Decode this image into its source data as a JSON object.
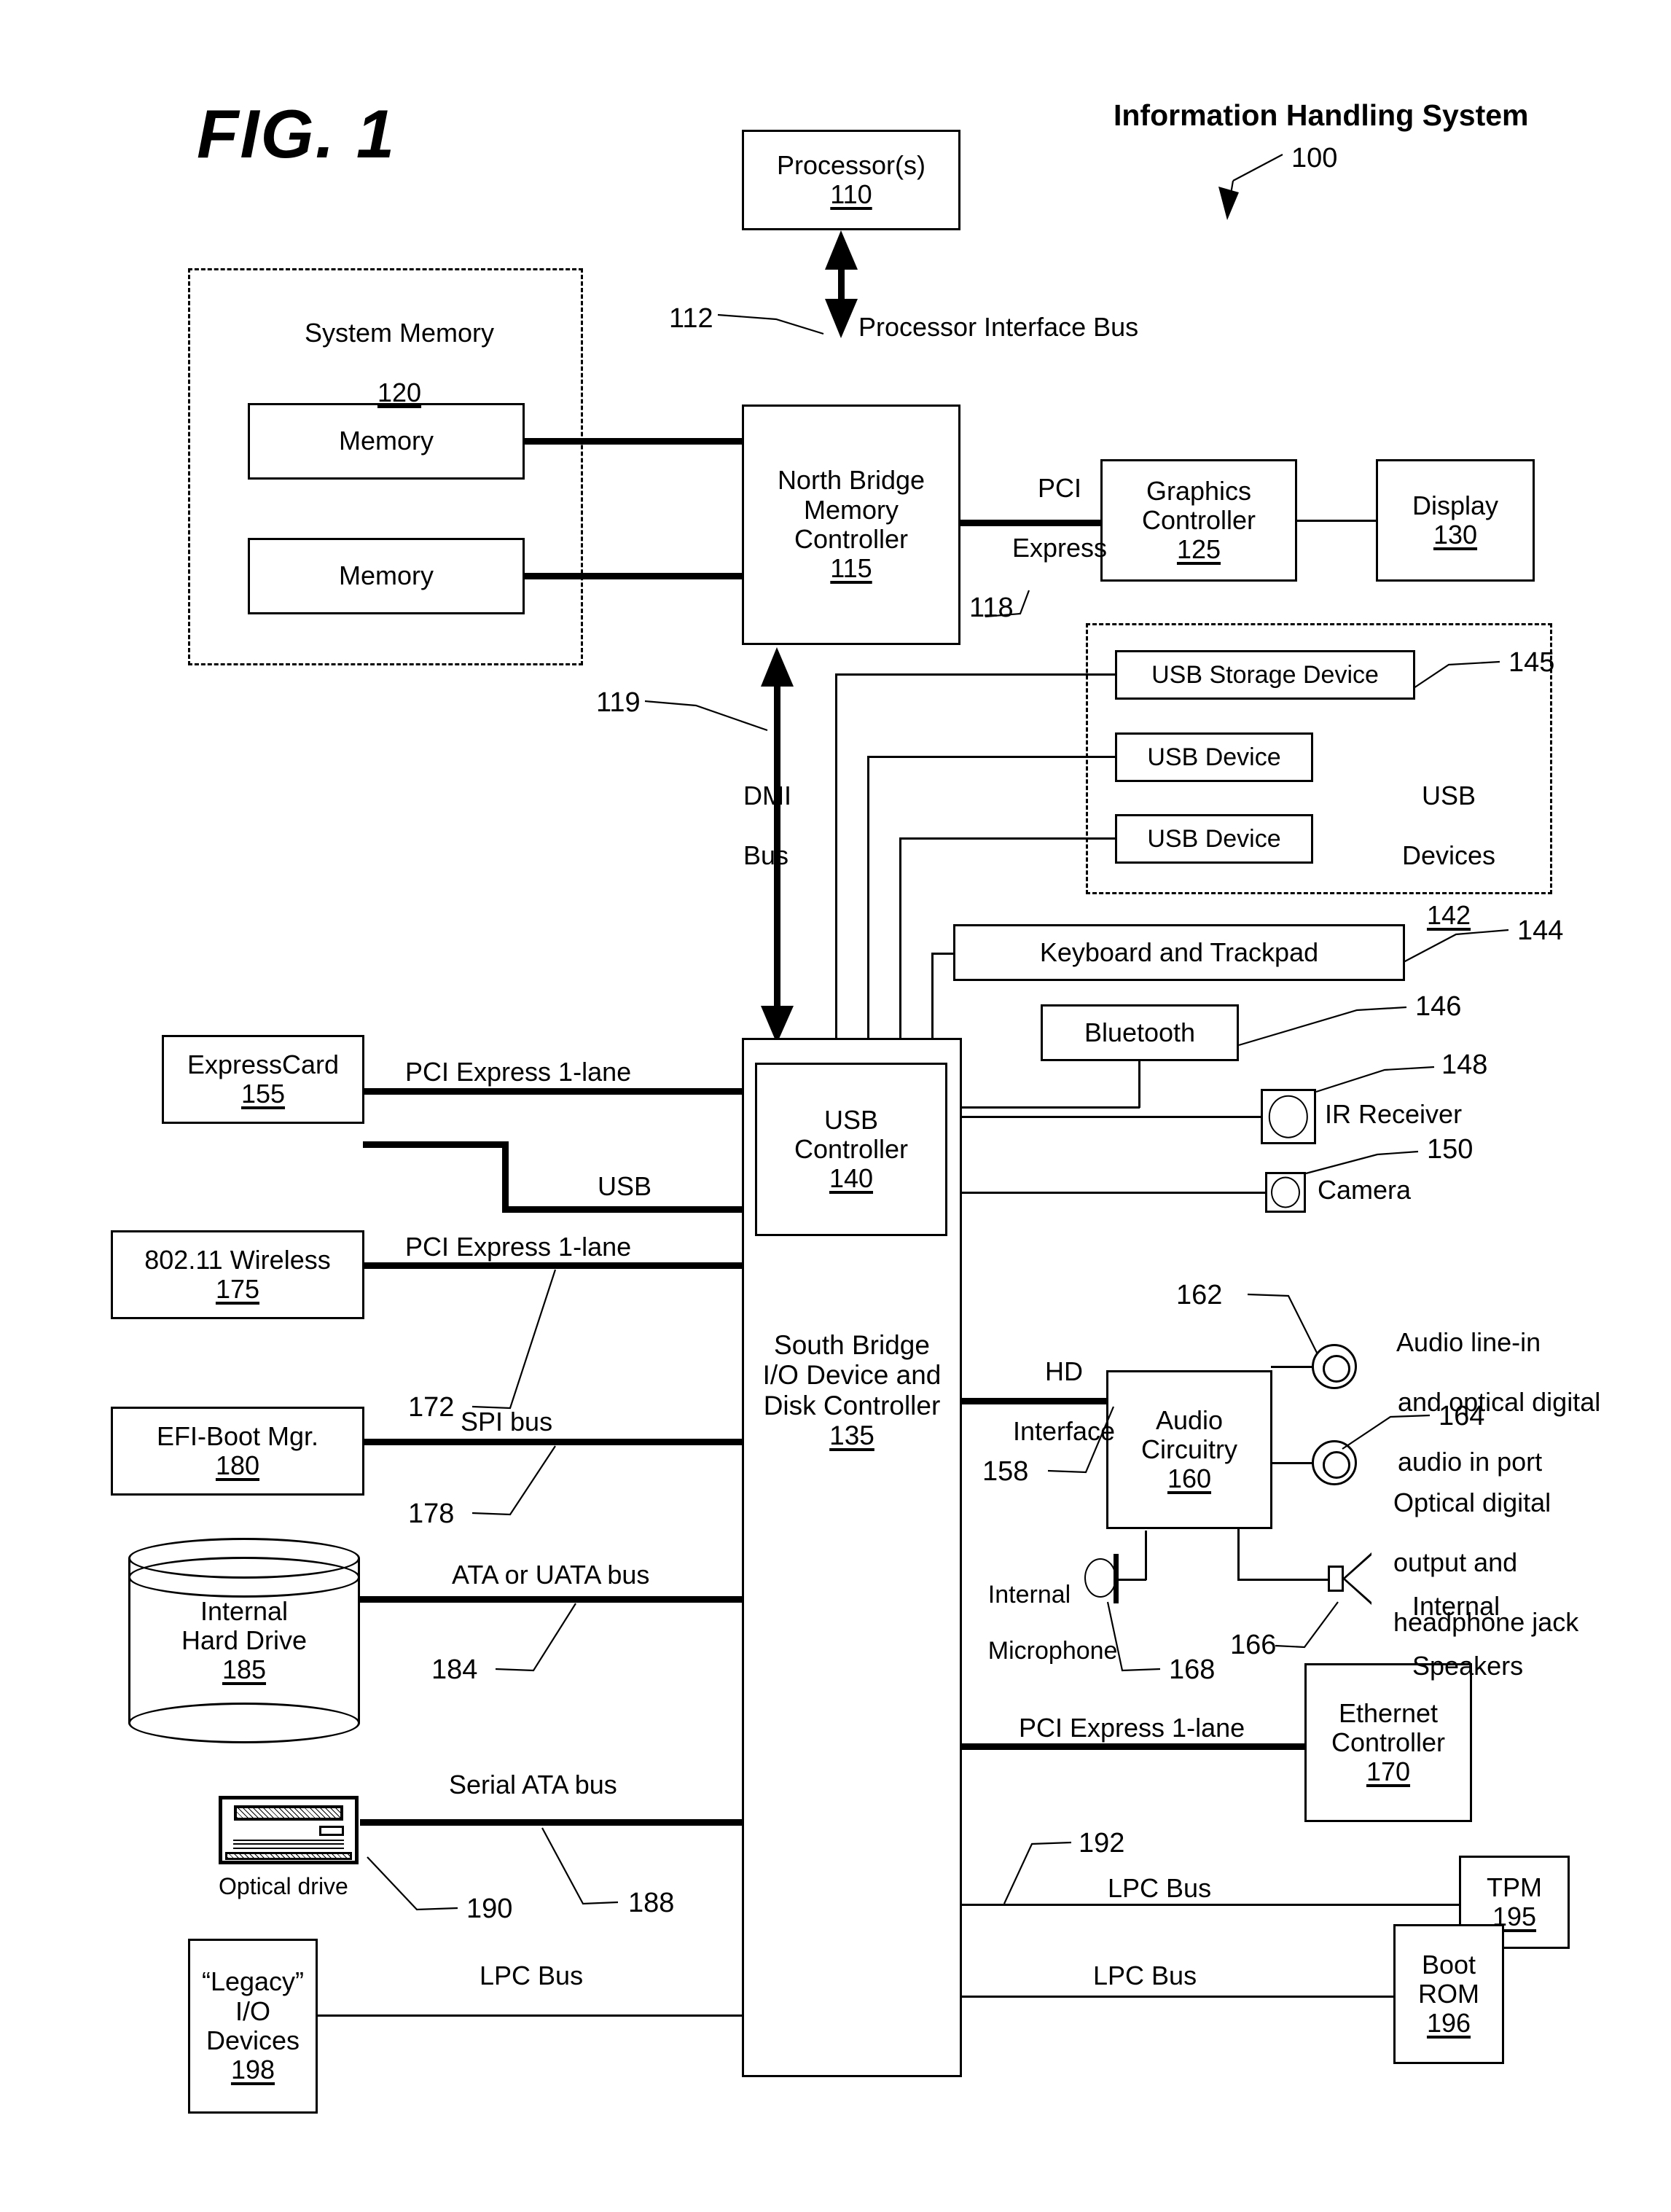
{
  "figure": {
    "fig_label": "FIG. 1",
    "system_title": "Information Handling System",
    "system_ref": "100"
  },
  "blocks": {
    "processor": {
      "title": "Processor(s)",
      "ref": "110"
    },
    "north_bridge": {
      "line1": "North Bridge",
      "line2": "Memory",
      "line3": "Controller",
      "ref": "115"
    },
    "system_memory": {
      "title": "System Memory",
      "ref": "120"
    },
    "memory_1": {
      "title": "Memory"
    },
    "memory_2": {
      "title": "Memory"
    },
    "graphics_controller": {
      "line1": "Graphics",
      "line2": "Controller",
      "ref": "125"
    },
    "display": {
      "title": "Display",
      "ref": "130"
    },
    "usb_storage_device": {
      "title": "USB Storage Device",
      "ref": "145"
    },
    "usb_device_1": {
      "title": "USB Device"
    },
    "usb_device_2": {
      "title": "USB Device"
    },
    "usb_devices_group": {
      "line1": "USB",
      "line2": "Devices",
      "ref": "142"
    },
    "keyboard_trackpad": {
      "title": "Keyboard and Trackpad",
      "ref": "144"
    },
    "bluetooth": {
      "title": "Bluetooth",
      "ref": "146"
    },
    "ir_receiver": {
      "title": "IR Receiver",
      "ref": "148"
    },
    "camera": {
      "title": "Camera",
      "ref": "150"
    },
    "usb_controller": {
      "line1": "USB",
      "line2": "Controller",
      "ref": "140"
    },
    "south_bridge": {
      "line1": "South Bridge",
      "line2": "I/O Device and",
      "line3": "Disk Controller",
      "ref": "135"
    },
    "expresscard": {
      "title": "ExpressCard",
      "ref": "155"
    },
    "wireless": {
      "title": "802.11 Wireless",
      "ref": "175"
    },
    "efi_boot_mgr": {
      "title": "EFI-Boot Mgr.",
      "ref": "180"
    },
    "internal_hard_drive": {
      "line1": "Internal",
      "line2": "Hard Drive",
      "ref": "185"
    },
    "optical_drive": {
      "title": "Optical drive",
      "ref": "190"
    },
    "legacy_io_devices": {
      "line1": "“Legacy”",
      "line2": "I/O",
      "line3": "Devices",
      "ref": "198"
    },
    "audio_circuitry": {
      "line1": "Audio",
      "line2": "Circuitry",
      "ref": "160"
    },
    "audio_line_in": {
      "line1": "Audio line-in",
      "line2": "and optical digital",
      "line3": "audio in port",
      "ref": "162"
    },
    "optical_out": {
      "line1": "Optical digital",
      "line2": "output and",
      "line3": "headphone jack",
      "ref": "164"
    },
    "internal_microphone": {
      "line1": "Internal",
      "line2": "Microphone",
      "ref": "168"
    },
    "internal_speakers": {
      "line1": "Internal",
      "line2": "Speakers",
      "ref": "166"
    },
    "ethernet_controller": {
      "line1": "Ethernet",
      "line2": "Controller",
      "ref": "170"
    },
    "tpm": {
      "title": "TPM",
      "ref": "195"
    },
    "boot_rom": {
      "line1": "Boot",
      "line2": "ROM",
      "ref": "196"
    }
  },
  "buses": {
    "processor_interface_bus": {
      "label": "Processor Interface Bus",
      "ref": "112"
    },
    "pci_express_gfx": {
      "line1": "PCI",
      "line2": "Express",
      "ref": "118"
    },
    "dmi_bus": {
      "line1": "DMI",
      "line2": "Bus",
      "ref": "119"
    },
    "pcie_expresscard": {
      "label": "PCI Express 1-lane"
    },
    "usb_expresscard": {
      "label": "USB"
    },
    "pcie_wireless": {
      "label": "PCI Express 1-lane",
      "ref": "172"
    },
    "spi_bus": {
      "label": "SPI bus",
      "ref": "178"
    },
    "ata_uata_bus": {
      "label": "ATA or UATA bus",
      "ref": "184"
    },
    "serial_ata_bus": {
      "label": "Serial ATA bus",
      "ref": "188"
    },
    "lpc_bus_legacy": {
      "label": "LPC Bus"
    },
    "lpc_bus_tpm": {
      "label": "LPC Bus",
      "ref": "192"
    },
    "lpc_bus_rom": {
      "label": "LPC Bus"
    },
    "hd_interface": {
      "line1": "HD",
      "line2": "Interface",
      "ref": "158"
    },
    "pcie_ethernet": {
      "label": "PCI Express 1-lane"
    }
  }
}
